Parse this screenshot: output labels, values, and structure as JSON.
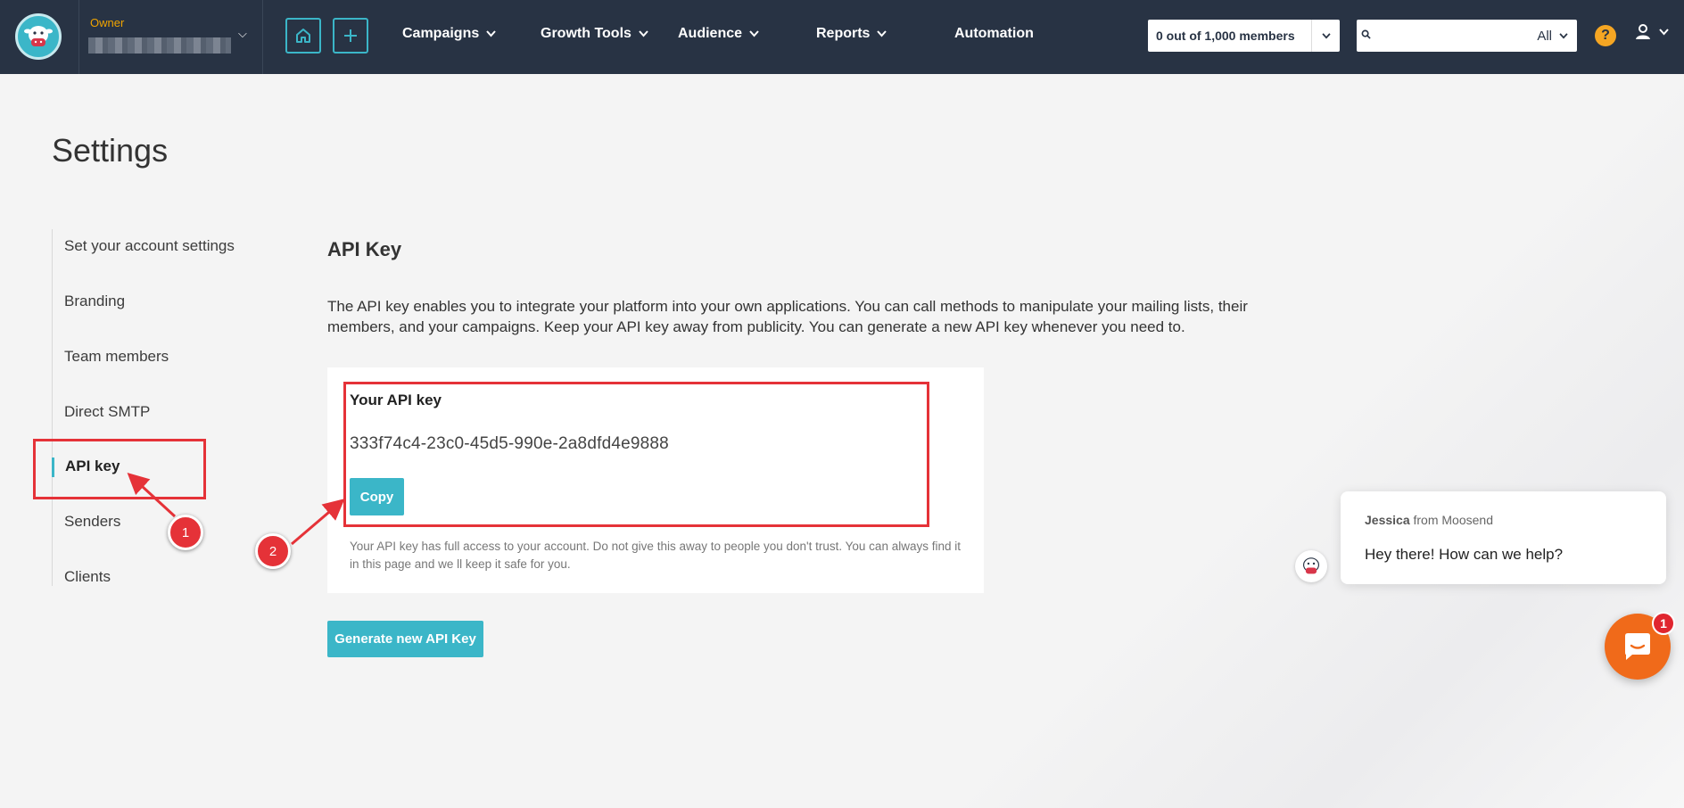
{
  "header": {
    "account_role": "Owner",
    "nav": [
      {
        "label": "Campaigns"
      },
      {
        "label": "Growth Tools"
      },
      {
        "label": "Audience"
      },
      {
        "label": "Reports"
      },
      {
        "label": "Automation"
      }
    ],
    "members_counter": "0 out of 1,000 members",
    "search": {
      "placeholder": "",
      "scope": "All"
    },
    "help_symbol": "?"
  },
  "page": {
    "title": "Settings"
  },
  "sidebar": {
    "items": [
      {
        "label": "Set your account settings"
      },
      {
        "label": "Branding"
      },
      {
        "label": "Team members"
      },
      {
        "label": "Direct SMTP"
      },
      {
        "label": "API key",
        "active": true
      },
      {
        "label": "Senders"
      },
      {
        "label": "Clients"
      }
    ]
  },
  "main": {
    "section_title": "API Key",
    "description": "The API key enables you to integrate your platform into your own applications. You can call methods to manipulate your mailing lists, their members, and your campaigns. Keep your API key away from publicity. You can generate a new API key whenever you need to.",
    "api_card": {
      "label": "Your API key",
      "key": "333f74c4-23c0-45d5-990e-2a8dfd4e9888",
      "copy_label": "Copy",
      "note": "Your API key has full access to your account. Do not give this away to people you don't trust. You can always find it in this page and we ll keep it safe for you."
    },
    "generate_label": "Generate new API Key"
  },
  "annotations": {
    "marker_1": "1",
    "marker_2": "2",
    "color": "#e53238"
  },
  "chat": {
    "agent_name": "Jessica",
    "agent_suffix": "from Moosend",
    "message": "Hey there! How can we help?",
    "badge_count": "1"
  },
  "colors": {
    "topbar": "#283344",
    "accent": "#3bb6c8",
    "owner": "#f0a400",
    "launcher": "#f06a1a"
  },
  "icons": [
    "logo-icon",
    "home-icon",
    "plus-icon",
    "search-icon",
    "help-icon",
    "user-icon",
    "chevron-down-icon",
    "chat-icon"
  ]
}
